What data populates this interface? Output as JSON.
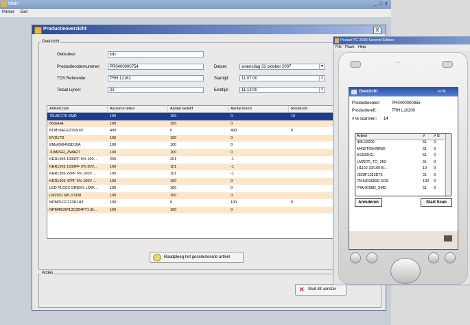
{
  "main": {
    "title": "Main",
    "menu": [
      "Printer",
      "Exit"
    ],
    "controls": "_ □ x"
  },
  "child": {
    "title": "Productieoverzicht",
    "close": "X",
    "overview_label": "Overzicht",
    "fields": {
      "gebruiker_label": "Gebruiker:",
      "gebruiker_value": "kdc",
      "productieorder_label": "Productieordernummer:",
      "productieorder_value": "PR0400000754",
      "tds_label": "TDS Referentie:",
      "tds_value": "TRH.12162",
      "totaal_label": "Totaal Lijnen:",
      "totaal_value": "23",
      "datum_label": "Datum:",
      "datum_value": "woensdag 31 oktober 2007",
      "starttijd_label": "Starttijd:",
      "starttijd_value": "11:07:00",
      "eindtijd_label": "Eindtijd:",
      "eindtijd_value": "11:13:00"
    },
    "table": {
      "headers": [
        "ArtikelCode",
        "Aantal te tellen",
        "Aantal Geteld",
        "Aantal tekort",
        "Reststock"
      ],
      "rows": [
        [
          "75LBC176 SMD",
          "100",
          "100",
          "0",
          "10"
        ],
        [
          "656EHA",
          "100",
          "100",
          "0",
          ""
        ],
        [
          "BLM18AG121SN1D",
          "400",
          "0",
          "400",
          "0"
        ],
        [
          "BYD17D",
          "100",
          "100",
          "0",
          ""
        ],
        [
          "EMs656HNSD16A",
          "100",
          "100",
          "0",
          ""
        ],
        [
          "JUMPER_ZWART",
          "100",
          "100",
          "0",
          ""
        ],
        [
          "KER1206 1000PF 5% 100...",
          "200",
          "201",
          "-1",
          ""
        ],
        [
          "KER1206 1500PF 5% 50V...",
          "100",
          "101",
          "-1",
          ""
        ],
        [
          "KER1206 22PF 5% 100V ...",
          "100",
          "101",
          "-1",
          ""
        ],
        [
          "KER1206 47PF 5% 100V ...",
          "100",
          "100",
          "0",
          ""
        ],
        [
          "LED PLCC2 GREEN LOW...",
          "100",
          "100",
          "0",
          ""
        ],
        [
          "LM2931 M5.0 SO8",
          "100",
          "100",
          "0",
          ""
        ],
        [
          "NPM21CC223R1H3",
          "100",
          "0",
          "100",
          "0"
        ],
        [
          "NPM4516P13C2B4FT1 (E...",
          "100",
          "100",
          "0",
          ""
        ]
      ]
    },
    "maintenance_button": "Raadpleeg het geselecteerde artikel",
    "actions_label": "Acties",
    "close_button": "Sluit dit venster"
  },
  "ppc": {
    "window_title": "Pocket PC 2003 Second Edition",
    "menu": [
      "File",
      "Flash",
      "Help"
    ],
    "bar_title": "Overzicht",
    "clock": "14:08",
    "order_label": "Productieorder:",
    "order_value": "PR0400000856",
    "ref_label": "Productiereff.:",
    "ref_value": "TRH.L10200",
    "scan_label": "# te scannen:",
    "scan_value": "14",
    "list_headers": [
      "Artikel",
      "#",
      "# G"
    ],
    "list_rows": [
      [
        "IKB.10200",
        "51",
        "0"
      ],
      [
        "M415T65HNR6E",
        "51",
        "0"
      ],
      [
        "KSD8DGL",
        "51",
        "0"
      ],
      [
        "LM2575_TO_263",
        "51",
        "0"
      ],
      [
        "H1102 33/100 B...",
        "19",
        "0"
      ],
      [
        "J528F1283D75",
        "51",
        "0"
      ],
      [
        "75HVD3082E SO8",
        "102",
        "0"
      ],
      [
        "74AHC08D_SMD",
        "51",
        "0"
      ]
    ],
    "cancel_button": "Annuleren",
    "start_button": "Start Scan"
  }
}
